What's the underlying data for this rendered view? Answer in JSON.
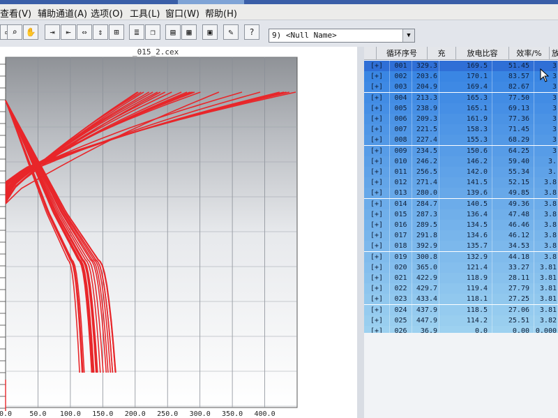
{
  "menu": {
    "items": [
      "查看(V)",
      "辅助通道(A)",
      "选项(O)",
      "工具(L)",
      "窗口(W)",
      "帮助(H)"
    ]
  },
  "toolbar": {
    "combo_value": "9) <Null Name>"
  },
  "chart": {
    "title": "_015_2.cex"
  },
  "chart_data": {
    "type": "line",
    "title": "_015_2.cex",
    "x_ticks": [
      "0.0",
      "50.0",
      "100.0",
      "150.0",
      "200.0",
      "250.0",
      "300.0",
      "350.0",
      "400.0"
    ],
    "xlim": [
      0,
      450
    ],
    "grid": true,
    "curve_color": "#e8262a",
    "charge_curves": [
      {
        "cycle": "001",
        "capacity": 329.3
      },
      {
        "cycle": "002",
        "capacity": 203.6
      },
      {
        "cycle": "003",
        "capacity": 204.9
      },
      {
        "cycle": "004",
        "capacity": 213.3
      },
      {
        "cycle": "005",
        "capacity": 238.9
      },
      {
        "cycle": "006",
        "capacity": 209.3
      },
      {
        "cycle": "007",
        "capacity": 221.5
      },
      {
        "cycle": "008",
        "capacity": 227.4
      },
      {
        "cycle": "009",
        "capacity": 234.5
      },
      {
        "cycle": "010",
        "capacity": 246.2
      },
      {
        "cycle": "011",
        "capacity": 256.5
      },
      {
        "cycle": "012",
        "capacity": 271.4
      },
      {
        "cycle": "013",
        "capacity": 280.0
      },
      {
        "cycle": "014",
        "capacity": 284.7
      },
      {
        "cycle": "015",
        "capacity": 287.3
      },
      {
        "cycle": "016",
        "capacity": 289.5
      },
      {
        "cycle": "017",
        "capacity": 291.8
      },
      {
        "cycle": "018",
        "capacity": 392.9
      },
      {
        "cycle": "019",
        "capacity": 300.8
      },
      {
        "cycle": "020",
        "capacity": 365.0
      },
      {
        "cycle": "021",
        "capacity": 422.9
      },
      {
        "cycle": "022",
        "capacity": 429.7
      },
      {
        "cycle": "023",
        "capacity": 433.4
      },
      {
        "cycle": "024",
        "capacity": 437.9
      },
      {
        "cycle": "025",
        "capacity": 447.9
      }
    ],
    "discharge_curves": [
      {
        "cycle": "001",
        "capacity": 169.5
      },
      {
        "cycle": "002",
        "capacity": 170.1
      },
      {
        "cycle": "003",
        "capacity": 169.4
      },
      {
        "cycle": "004",
        "capacity": 165.3
      },
      {
        "cycle": "005",
        "capacity": 165.1
      },
      {
        "cycle": "006",
        "capacity": 161.9
      },
      {
        "cycle": "007",
        "capacity": 158.3
      },
      {
        "cycle": "008",
        "capacity": 155.3
      },
      {
        "cycle": "009",
        "capacity": 150.6
      },
      {
        "cycle": "010",
        "capacity": 146.2
      },
      {
        "cycle": "011",
        "capacity": 142.0
      },
      {
        "cycle": "012",
        "capacity": 141.5
      },
      {
        "cycle": "013",
        "capacity": 139.6
      },
      {
        "cycle": "014",
        "capacity": 140.5
      },
      {
        "cycle": "015",
        "capacity": 136.4
      },
      {
        "cycle": "016",
        "capacity": 134.5
      },
      {
        "cycle": "017",
        "capacity": 134.6
      },
      {
        "cycle": "018",
        "capacity": 135.7
      },
      {
        "cycle": "019",
        "capacity": 132.9
      },
      {
        "cycle": "020",
        "capacity": 121.4
      },
      {
        "cycle": "021",
        "capacity": 118.9
      },
      {
        "cycle": "022",
        "capacity": 119.4
      },
      {
        "cycle": "023",
        "capacity": 118.1
      },
      {
        "cycle": "024",
        "capacity": 118.5
      },
      {
        "cycle": "025",
        "capacity": 114.2
      }
    ]
  },
  "table": {
    "headers": [
      "",
      "循环序号",
      "充",
      "放电比容",
      "效率/%",
      "放电中"
    ],
    "rows": [
      {
        "exp": "[+]",
        "idx": "001",
        "charge": "329.3",
        "discharge": "169.5",
        "eff": "51.45",
        "v": "3"
      },
      {
        "exp": "[+]",
        "idx": "002",
        "charge": "203.6",
        "discharge": "170.1",
        "eff": "83.57",
        "v": "3"
      },
      {
        "exp": "[+]",
        "idx": "003",
        "charge": "204.9",
        "discharge": "169.4",
        "eff": "82.67",
        "v": "3"
      },
      {
        "exp": "[+]",
        "idx": "004",
        "charge": "213.3",
        "discharge": "165.3",
        "eff": "77.50",
        "v": "3"
      },
      {
        "exp": "[+]",
        "idx": "005",
        "charge": "238.9",
        "discharge": "165.1",
        "eff": "69.13",
        "v": "3"
      },
      {
        "exp": "[+]",
        "idx": "006",
        "charge": "209.3",
        "discharge": "161.9",
        "eff": "77.36",
        "v": "3"
      },
      {
        "exp": "[+]",
        "idx": "007",
        "charge": "221.5",
        "discharge": "158.3",
        "eff": "71.45",
        "v": "3"
      },
      {
        "exp": "[+]",
        "idx": "008",
        "charge": "227.4",
        "discharge": "155.3",
        "eff": "68.29",
        "v": "3"
      },
      {
        "exp": "[+]",
        "idx": "009",
        "charge": "234.5",
        "discharge": "150.6",
        "eff": "64.25",
        "v": "3"
      },
      {
        "exp": "[+]",
        "idx": "010",
        "charge": "246.2",
        "discharge": "146.2",
        "eff": "59.40",
        "v": "3."
      },
      {
        "exp": "[+]",
        "idx": "011",
        "charge": "256.5",
        "discharge": "142.0",
        "eff": "55.34",
        "v": "3."
      },
      {
        "exp": "[+]",
        "idx": "012",
        "charge": "271.4",
        "discharge": "141.5",
        "eff": "52.15",
        "v": "3.8"
      },
      {
        "exp": "[+]",
        "idx": "013",
        "charge": "280.0",
        "discharge": "139.6",
        "eff": "49.85",
        "v": "3.8"
      },
      {
        "exp": "[+]",
        "idx": "014",
        "charge": "284.7",
        "discharge": "140.5",
        "eff": "49.36",
        "v": "3.8"
      },
      {
        "exp": "[+]",
        "idx": "015",
        "charge": "287.3",
        "discharge": "136.4",
        "eff": "47.48",
        "v": "3.8"
      },
      {
        "exp": "[+]",
        "idx": "016",
        "charge": "289.5",
        "discharge": "134.5",
        "eff": "46.46",
        "v": "3.8"
      },
      {
        "exp": "[+]",
        "idx": "017",
        "charge": "291.8",
        "discharge": "134.6",
        "eff": "46.12",
        "v": "3.8"
      },
      {
        "exp": "[+]",
        "idx": "018",
        "charge": "392.9",
        "discharge": "135.7",
        "eff": "34.53",
        "v": "3.8"
      },
      {
        "exp": "[+]",
        "idx": "019",
        "charge": "300.8",
        "discharge": "132.9",
        "eff": "44.18",
        "v": "3.8"
      },
      {
        "exp": "[+]",
        "idx": "020",
        "charge": "365.0",
        "discharge": "121.4",
        "eff": "33.27",
        "v": "3.81"
      },
      {
        "exp": "[+]",
        "idx": "021",
        "charge": "422.9",
        "discharge": "118.9",
        "eff": "28.11",
        "v": "3.81"
      },
      {
        "exp": "[+]",
        "idx": "022",
        "charge": "429.7",
        "discharge": "119.4",
        "eff": "27.79",
        "v": "3.81"
      },
      {
        "exp": "[+]",
        "idx": "023",
        "charge": "433.4",
        "discharge": "118.1",
        "eff": "27.25",
        "v": "3.81"
      },
      {
        "exp": "[+]",
        "idx": "024",
        "charge": "437.9",
        "discharge": "118.5",
        "eff": "27.06",
        "v": "3.81"
      },
      {
        "exp": "[+]",
        "idx": "025",
        "charge": "447.9",
        "discharge": "114.2",
        "eff": "25.51",
        "v": "3.82"
      },
      {
        "exp": "[+]",
        "idx": "026",
        "charge": "36.9",
        "discharge": "0.0",
        "eff": "0.00",
        "v": "0.000"
      }
    ]
  },
  "colors": {
    "selected_row": "#2f6fd6",
    "row_gradient_start": "#3a86e3",
    "row_gradient_end": "#9dd1f0",
    "curve": "#e8262a"
  }
}
